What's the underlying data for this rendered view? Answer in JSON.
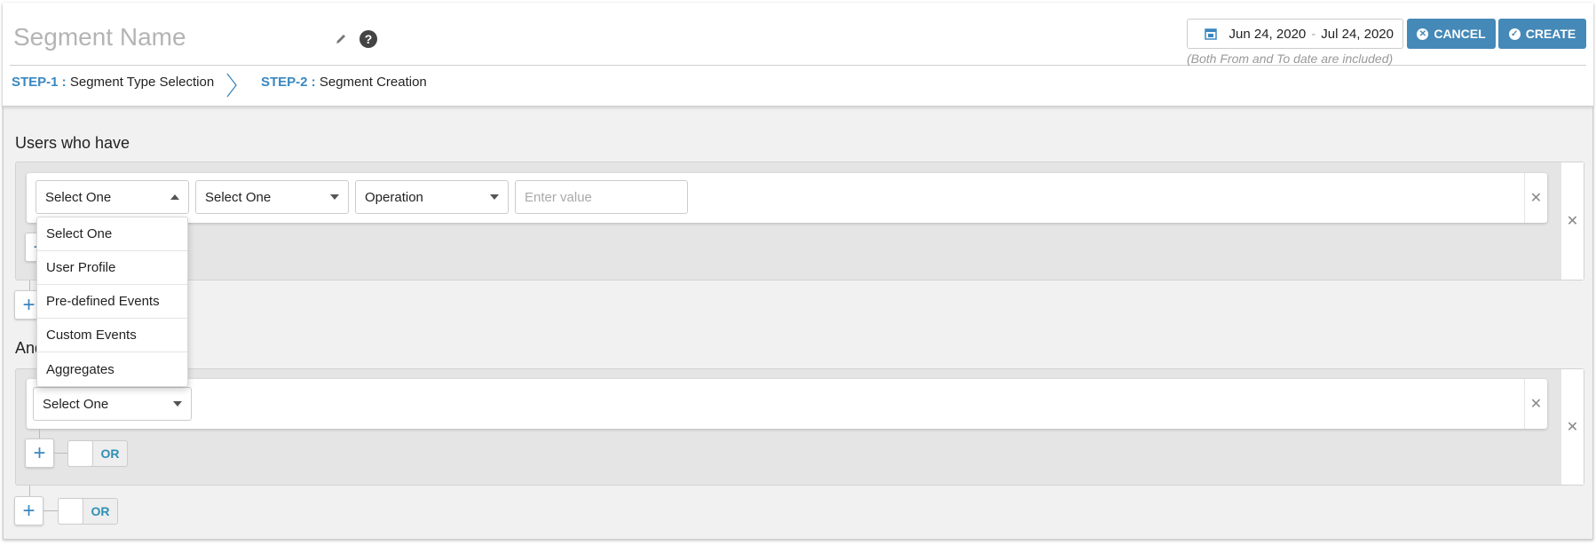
{
  "header": {
    "segment_name_placeholder": "Segment Name",
    "steps": [
      {
        "num": "STEP-1 :",
        "label": "Segment Type Selection"
      },
      {
        "num": "STEP-2 :",
        "label": "Segment Creation"
      }
    ],
    "date_range": {
      "from": "Jun 24, 2020",
      "sep": "-",
      "to": "Jul 24, 2020",
      "note": "(Both From and To date are included)"
    },
    "cancel_label": "CANCEL",
    "create_label": "CREATE"
  },
  "colors": {
    "primary": "#4589b8",
    "step": "#3a87c0"
  },
  "groups": [
    {
      "label": "Users who have",
      "selects": [
        "Select One",
        "Select One",
        "Operation"
      ],
      "value_placeholder": "Enter value",
      "dropdown": {
        "open": true,
        "options": [
          "Select One",
          "User Profile",
          "Pre-defined Events",
          "Custom Events",
          "Aggregates"
        ]
      }
    },
    {
      "label": "And",
      "selects": [
        "Select One"
      ]
    }
  ],
  "or_label": "OR",
  "icons": {
    "edit": "pencil-icon",
    "help": "question-circle-icon",
    "calendar": "calendar-icon",
    "remove": "close-icon",
    "add": "plus-icon"
  }
}
